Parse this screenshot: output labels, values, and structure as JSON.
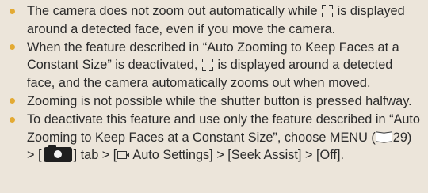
{
  "notes": [
    {
      "part1": "The camera does not zoom out automatically while",
      "part2": "is displayed around a detected face, even if you move the camera."
    },
    {
      "part1": "When the feature described in “Auto Zooming to Keep Faces at a Constant Size” is deactivated,",
      "part2": "is displayed around a detected face, and the camera automatically zooms out when moved."
    },
    {
      "text": "Zooming is not possible while the shutter button is pressed halfway."
    },
    {
      "part1": "To deactivate this feature and use only the feature described in “Auto Zooming to Keep Faces at a Constant Size”, choose MENU (",
      "page_ref": "29",
      "part2": ") > [",
      "part3": "] tab > [",
      "part4": "Auto Settings] > [Seek Assist] > [Off]."
    }
  ],
  "icons": {
    "bullet": "bullet-dot",
    "face_frame": "face-frame-icon",
    "page_ref": "book-icon",
    "shooting_tab": "camera-icon",
    "movie_mode": "movie-icon"
  },
  "colors": {
    "background": "#ece5da",
    "bullet": "#e3aa33",
    "text": "#2b2b2b"
  }
}
